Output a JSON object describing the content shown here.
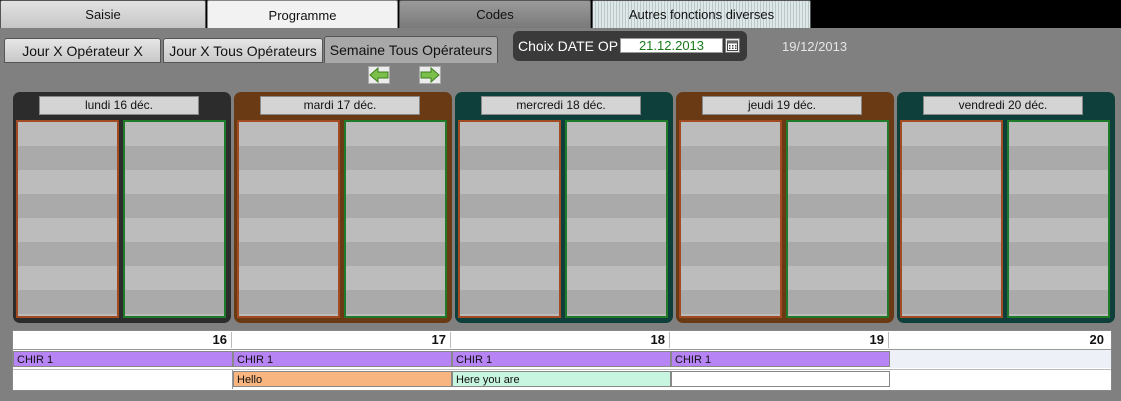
{
  "top_tabs": [
    "Saisie",
    "Programme",
    "Codes",
    "Autres fonctions diverses"
  ],
  "sub_tabs": [
    "Jour X Opérateur X",
    "Jour X Tous Opérateurs",
    "Semaine Tous Opérateurs"
  ],
  "date_choice": {
    "label": "Choix DATE OP",
    "value": "21.12.2013"
  },
  "current_date": "19/12/2013",
  "days": [
    {
      "label": "lundi 16 déc.",
      "frame_color": "#2c2c2c",
      "left_border": "#a24a22",
      "right_border": "#1f7a2a"
    },
    {
      "label": "mardi 17 déc.",
      "frame_color": "#6a3a14",
      "left_border": "#a24a22",
      "right_border": "#1f7a2a"
    },
    {
      "label": "mercredi 18 déc.",
      "frame_color": "#0f3f3a",
      "left_border": "#a24a22",
      "right_border": "#1f7a2a"
    },
    {
      "label": "jeudi 19 déc.",
      "frame_color": "#6a3a14",
      "left_border": "#a24a22",
      "right_border": "#1f7a2a"
    },
    {
      "label": "vendredi 20 déc.",
      "frame_color": "#0f3f3a",
      "left_border": "#a24a22",
      "right_border": "#1f7a2a"
    }
  ],
  "timeline": {
    "day_numbers": [
      "16",
      "17",
      "18",
      "19",
      "20"
    ],
    "chir_label": "CHIR 1",
    "events": [
      {
        "text": "Hello",
        "color": "#f9b57f"
      },
      {
        "text": "Here you are",
        "color": "#c8f5e0"
      }
    ]
  },
  "colors": {
    "chir": "#b784f5",
    "panel": "#808080"
  }
}
